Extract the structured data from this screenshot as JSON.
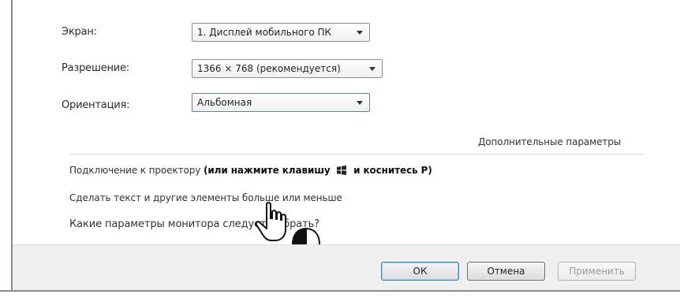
{
  "settings": {
    "screen_label": "Экран:",
    "screen_value": "1. Дисплей мобильного ПК",
    "resolution_label": "Разрешение:",
    "resolution_value": "1366 × 768 (рекомендуется)",
    "orientation_label": "Ориентация:",
    "orientation_value": "Альбомная",
    "advanced_link": "Дополнительные параметры"
  },
  "links": {
    "projector_prefix": "Подключение к проектору",
    "projector_bold_1": "(или нажмите клавишу",
    "projector_bold_2": "и коснитесь P)",
    "text_size": "Сделать текст и другие элементы больше или меньше",
    "monitor_params": "Какие параметры монитора следует выбрать?"
  },
  "buttons": {
    "ok": "ОК",
    "cancel": "Отмена",
    "apply": "Применить"
  },
  "icons": {
    "windows_key": "windows-logo-icon",
    "hand_cursor": "hand-pointer-icon",
    "mouse": "mouse-left-click-icon"
  },
  "colors": {
    "accent_focus": "#5e7fb0",
    "default_button": "#3c7fb1",
    "footer_bg": "#f0f0f0"
  }
}
